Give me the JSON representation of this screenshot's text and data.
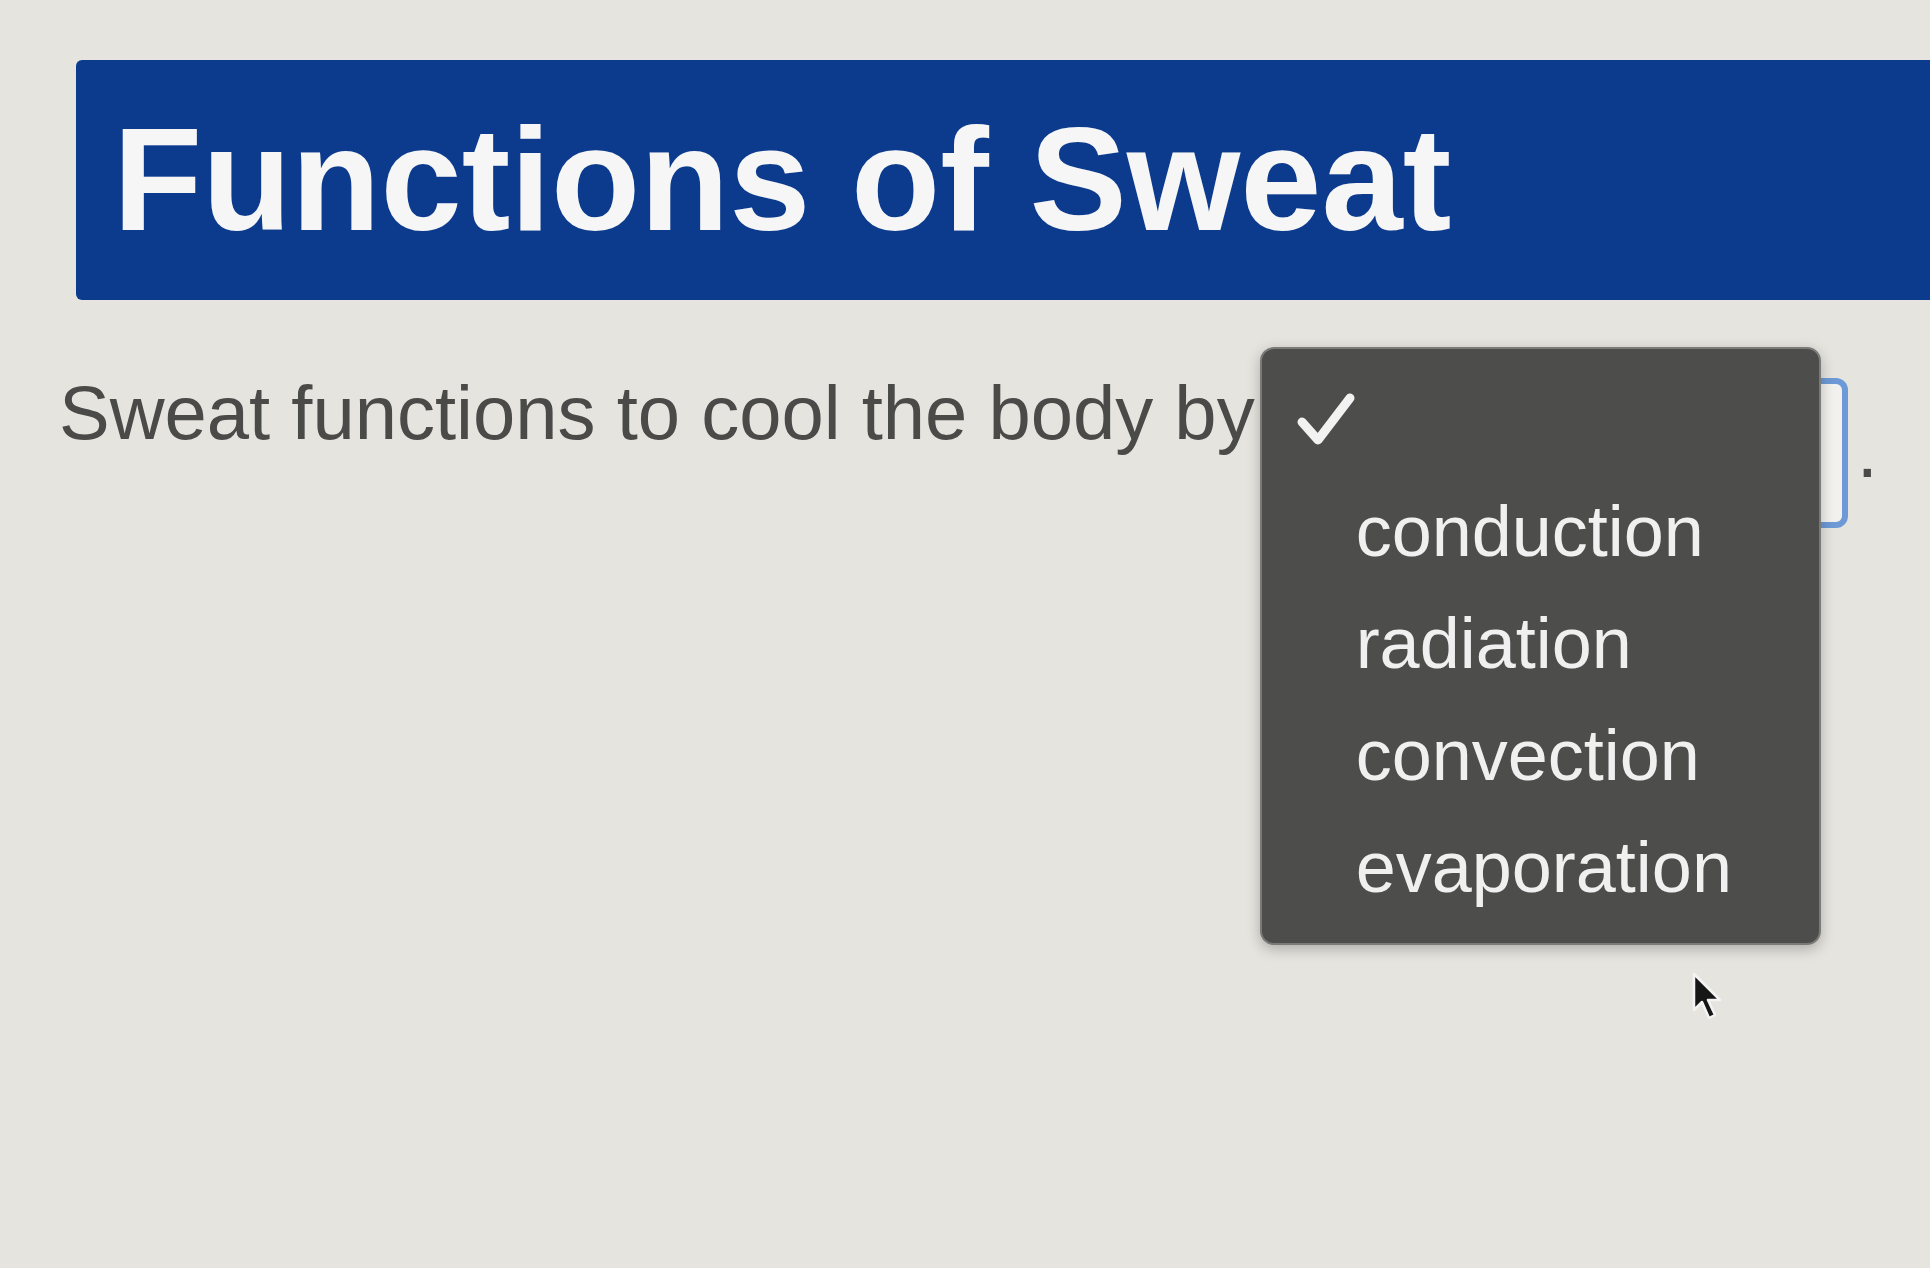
{
  "heading": "Functions of Sweat",
  "question": {
    "text": "Sweat functions to cool the body by",
    "after": ".",
    "select": {
      "focused": true,
      "expanded": true,
      "options": [
        {
          "kind": "blank",
          "selected": true
        },
        {
          "kind": "text",
          "label": "conduction",
          "selected": false
        },
        {
          "kind": "text",
          "label": "radiation",
          "selected": false
        },
        {
          "kind": "text",
          "label": "convection",
          "selected": false
        },
        {
          "kind": "text",
          "label": "evaporation",
          "selected": false
        }
      ]
    }
  }
}
